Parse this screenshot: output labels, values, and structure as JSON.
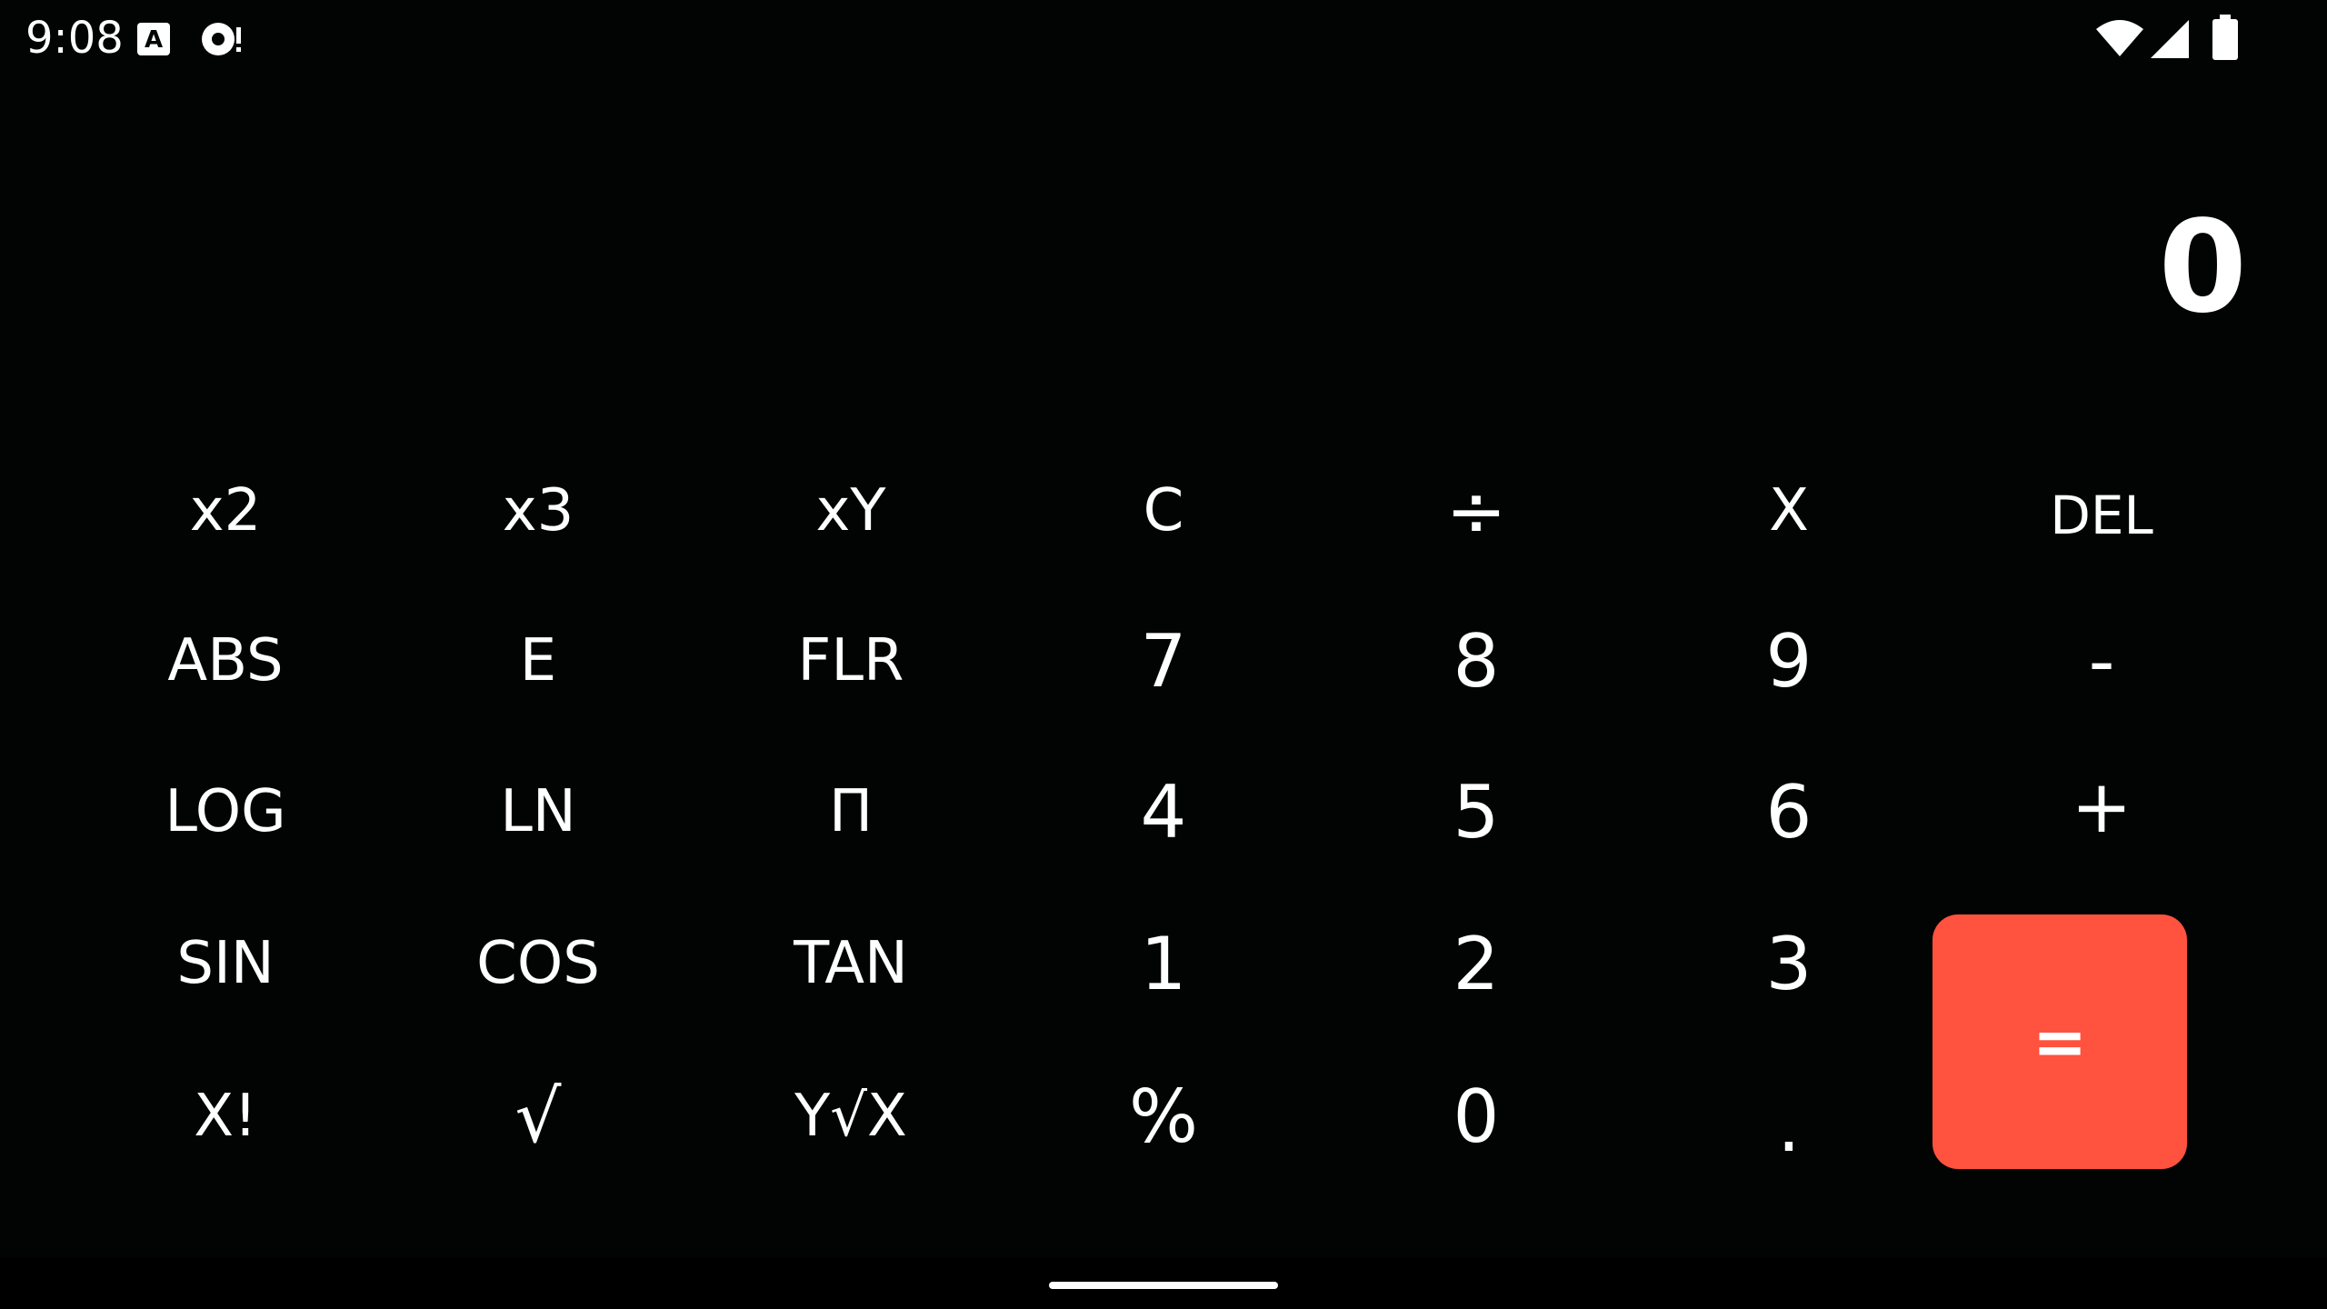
{
  "status_bar": {
    "time": "9:08",
    "left_icons": [
      "a-notification-icon",
      "record-alert-icon"
    ],
    "right_icons": [
      "wifi-icon",
      "cell-signal-icon",
      "battery-icon"
    ]
  },
  "display": {
    "value": "0"
  },
  "keys": {
    "row1": [
      "x2",
      "x3",
      "xY",
      "C",
      "÷",
      "X",
      "DEL"
    ],
    "row2": [
      "ABS",
      "E",
      "FLR",
      "7",
      "8",
      "9",
      "-"
    ],
    "row3": [
      "LOG",
      "LN",
      "Π",
      "4",
      "5",
      "6",
      "+"
    ],
    "row4": [
      "SIN",
      "COS",
      "TAN",
      "1",
      "2",
      "3"
    ],
    "row5": [
      "X!",
      "√",
      "Y√X",
      "%",
      "0",
      "."
    ],
    "equals": "="
  },
  "colors": {
    "background": "#020404",
    "equals_button": "#ff523f",
    "text": "#ffffff"
  }
}
